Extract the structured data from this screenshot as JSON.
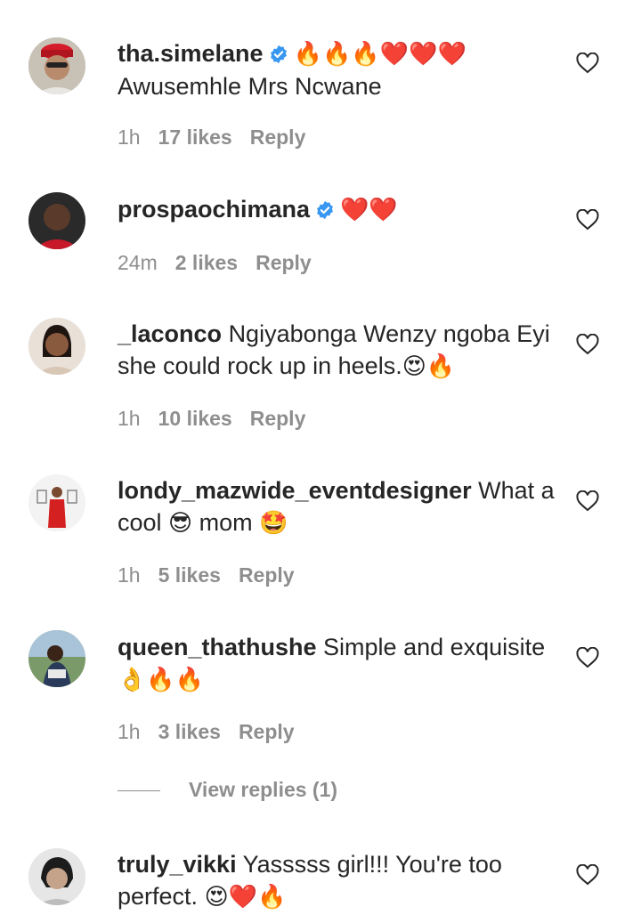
{
  "comments": [
    {
      "username": "tha.simelane",
      "verified": true,
      "text": "",
      "emoji_line": "🔥🔥🔥❤️❤️❤️",
      "second_line": "Awusemhle Mrs Ncwane",
      "time": "1h",
      "likes": "17 likes",
      "reply": "Reply"
    },
    {
      "username": "prospaochimana",
      "verified": true,
      "text": "",
      "emoji_line": "❤️❤️",
      "second_line": "",
      "time": "24m",
      "likes": "2 likes",
      "reply": "Reply"
    },
    {
      "username": "_laconco",
      "verified": false,
      "text": "Ngiyabonga Wenzy ngoba Eyi she could rock up in heels.",
      "emoji_line": "😍🔥",
      "second_line": "",
      "time": "1h",
      "likes": "10 likes",
      "reply": "Reply"
    },
    {
      "username": "londy_mazwide_eventdesigner",
      "verified": false,
      "text": "What a cool",
      "text2": "mom",
      "emoji_mid": "😎",
      "emoji_line": "🤩",
      "time": "1h",
      "likes": "5 likes",
      "reply": "Reply"
    },
    {
      "username": "queen_thathushe",
      "verified": false,
      "text": "Simple and exquisite",
      "emoji_line": "👌🔥🔥",
      "time": "1h",
      "likes": "3 likes",
      "reply": "Reply"
    },
    {
      "username": "truly_vikki",
      "verified": false,
      "text": "Yasssss girl!!! You're too perfect.",
      "emoji_line": "😍❤️🔥",
      "time": "",
      "likes": "",
      "reply": ""
    }
  ],
  "view_replies": "View replies (1)",
  "icons": {
    "heart": "heart-outline-icon",
    "verified": "verified-badge-icon"
  },
  "colors": {
    "text": "#262626",
    "meta": "#8e8e8e",
    "verified": "#3897f0"
  }
}
